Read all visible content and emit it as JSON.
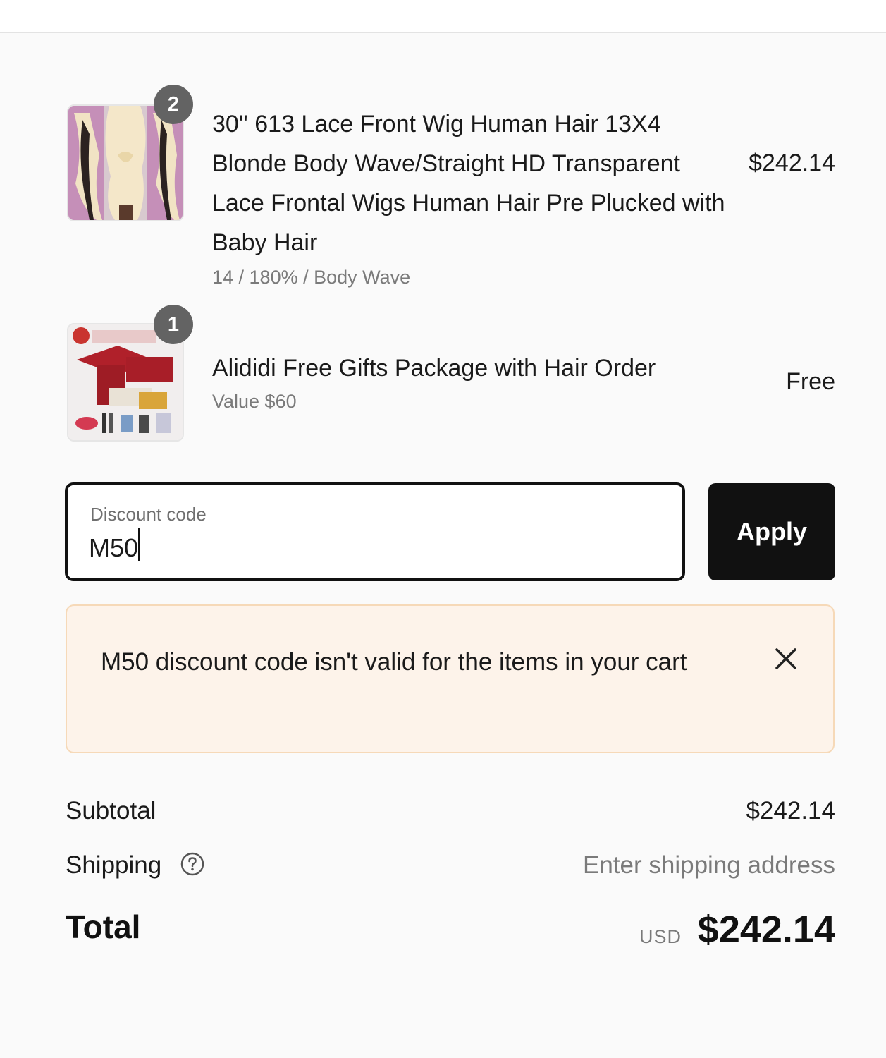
{
  "cart": {
    "items": [
      {
        "quantity": "2",
        "title": "30'' 613 Lace Front Wig Human Hair 13X4 Blonde Body Wave/Straight HD Transparent Lace Frontal Wigs Human Hair Pre Plucked with Baby Hair",
        "variant": "14 / 180% / Body Wave",
        "price": "$242.14"
      },
      {
        "quantity": "1",
        "title": "Alididi Free Gifts Package with Hair Order",
        "variant": "Value $60",
        "price": "Free"
      }
    ]
  },
  "discount": {
    "label": "Discount code",
    "value": "M50",
    "apply_label": "Apply"
  },
  "error": {
    "message": "M50 discount code isn't valid for the items in your cart"
  },
  "summary": {
    "subtotal_label": "Subtotal",
    "subtotal_value": "$242.14",
    "shipping_label": "Shipping",
    "shipping_value": "Enter shipping address",
    "total_label": "Total",
    "total_currency": "USD",
    "total_value": "$242.14"
  },
  "colors": {
    "button_bg": "#111111",
    "error_bg": "#fdf3ea",
    "error_border": "#f6d9b8",
    "badge_bg": "#636363"
  }
}
